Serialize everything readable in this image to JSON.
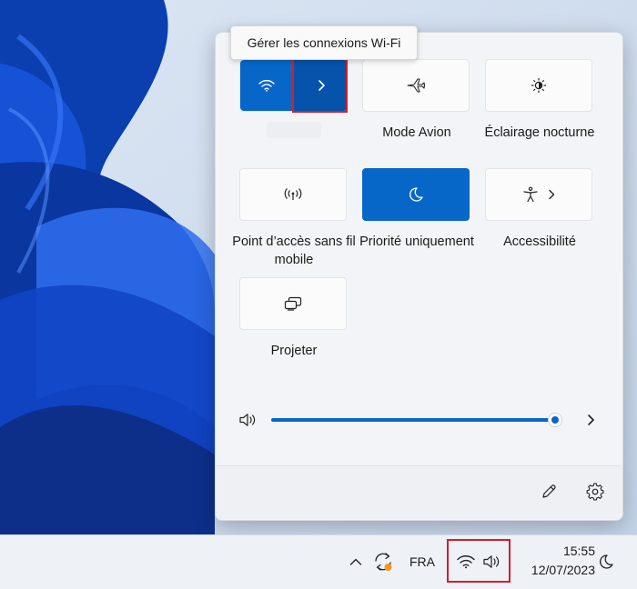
{
  "tooltip": {
    "text": "Gérer les connexions Wi-Fi"
  },
  "tiles": {
    "wifi": {
      "icon": "wifi-icon",
      "expand_icon": "chevron-right-icon"
    },
    "airplane": {
      "label": "Mode Avion",
      "icon": "airplane-icon"
    },
    "night_light": {
      "label": "Éclairage nocturne",
      "icon": "brightness-icon"
    },
    "hotspot": {
      "label": "Point d’accès sans fil mobile",
      "icon": "hotspot-icon"
    },
    "focus": {
      "label": "Priorité uniquement",
      "icon": "moon-icon"
    },
    "accessibility": {
      "label": "Accessibilité",
      "icon": "accessibility-icon"
    },
    "cast": {
      "label": "Projeter",
      "icon": "cast-icon"
    }
  },
  "volume": {
    "level_percent": 100,
    "icon": "speaker-icon",
    "expand_icon": "chevron-right-icon"
  },
  "footer": {
    "edit_icon": "pencil-icon",
    "settings_icon": "gear-icon"
  },
  "taskbar": {
    "language": "FRA",
    "time": "15:55",
    "date": "12/07/2023",
    "icons": [
      "chevron-up-icon",
      "sync-icon",
      "wifi-icon",
      "speaker-icon",
      "moon-icon"
    ]
  },
  "colors": {
    "accent": "#0667c9",
    "accent_dark": "#0553aa",
    "highlight": "#d21f2a"
  }
}
